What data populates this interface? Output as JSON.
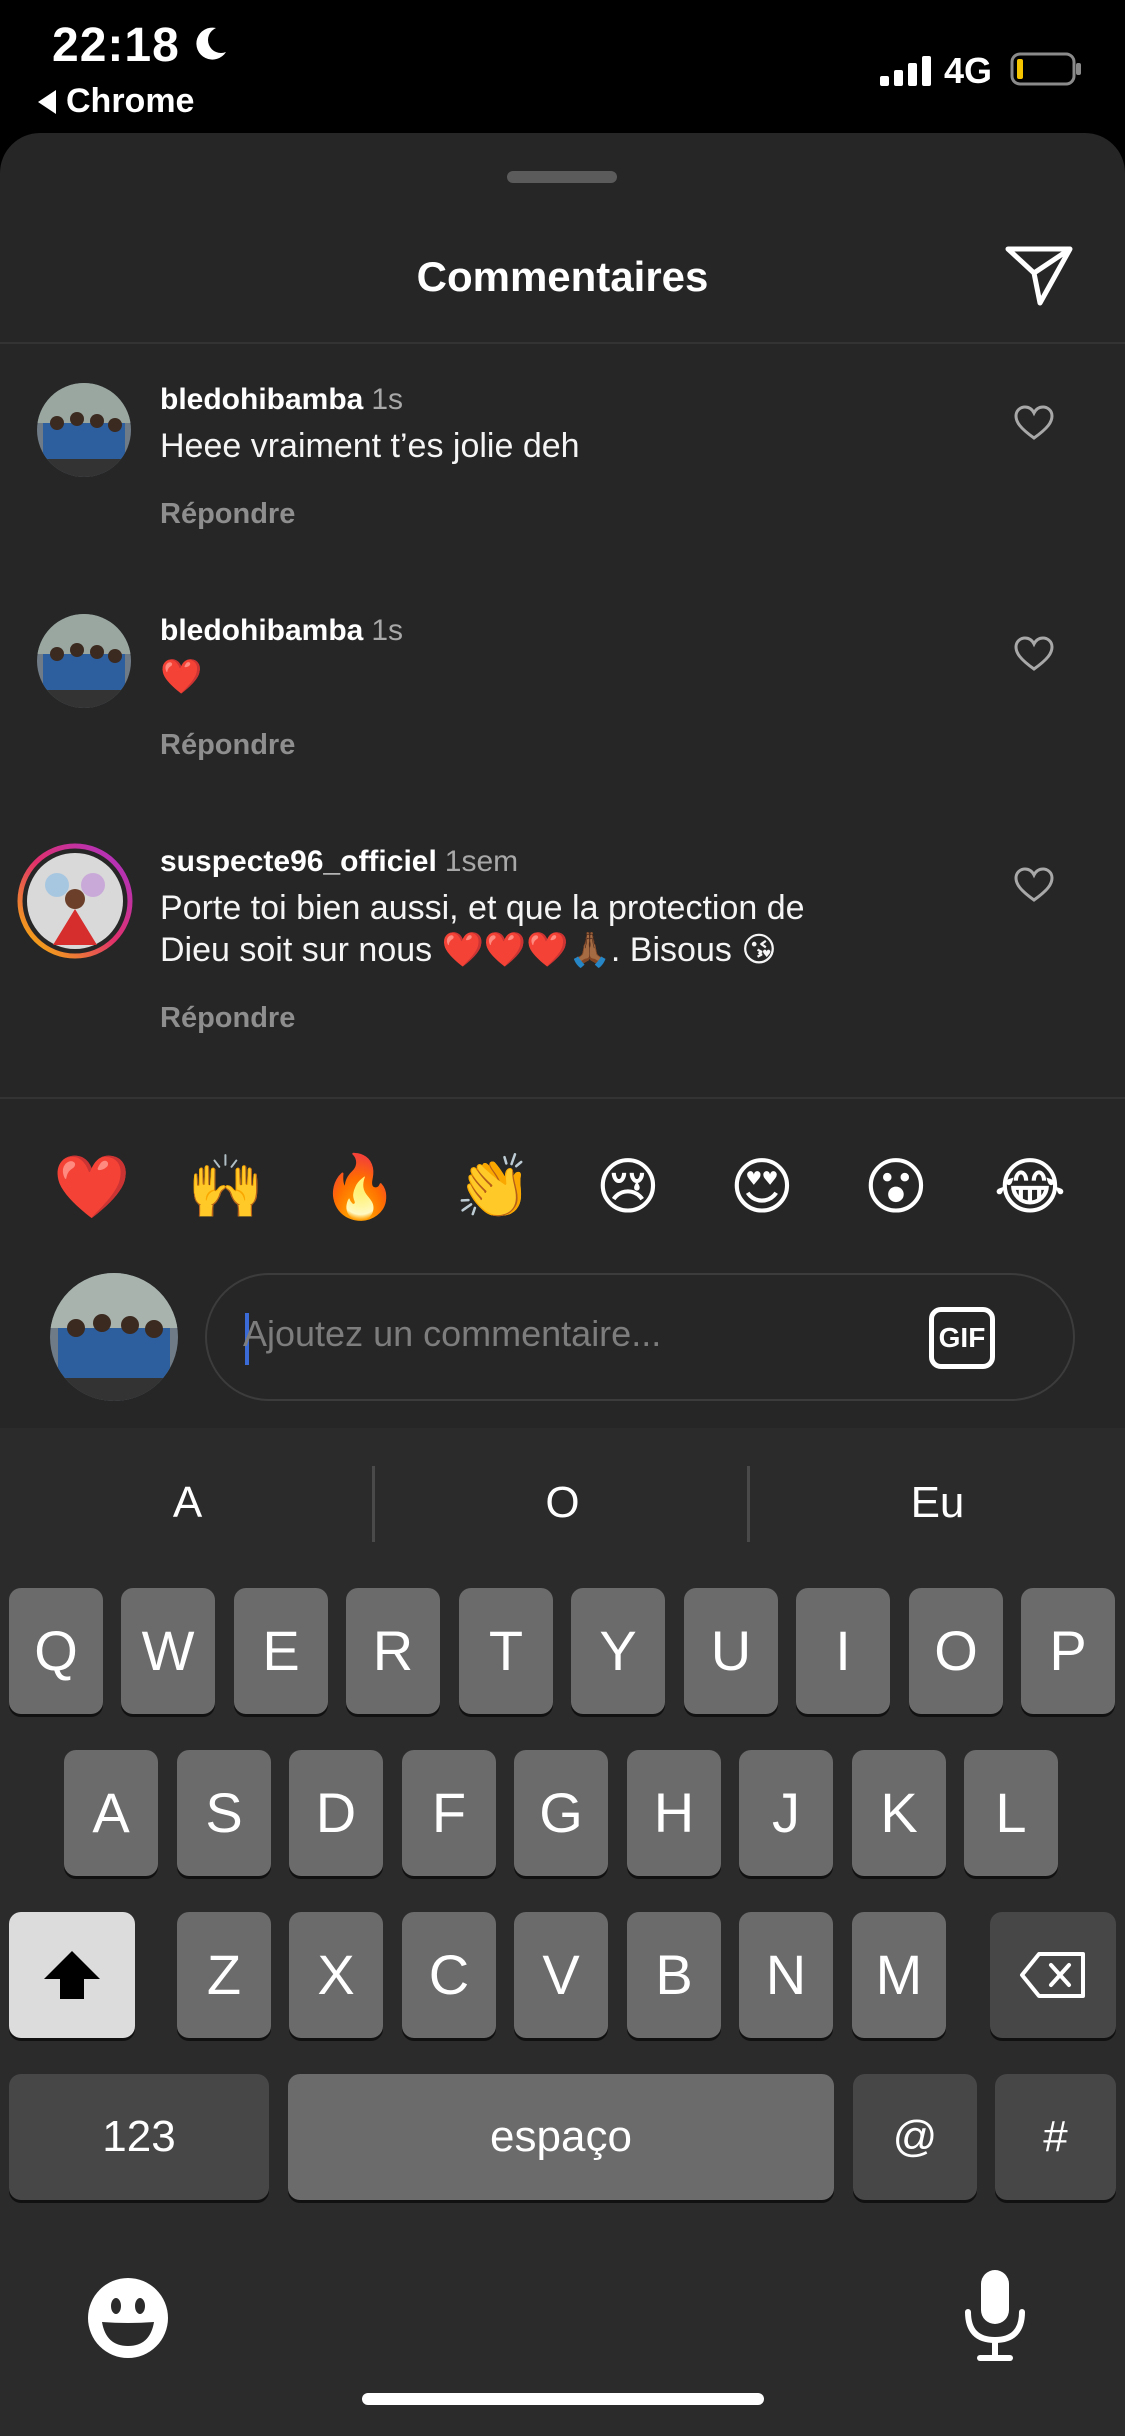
{
  "status_bar": {
    "time": "22:18",
    "back_label": "Chrome",
    "network": "4G"
  },
  "sheet": {
    "title": "Commentaires"
  },
  "comments": [
    {
      "username": "bledohibamba",
      "time": "1s",
      "text": "Heee vraiment t’es jolie deh",
      "reply": "Répondre"
    },
    {
      "username": "bledohibamba",
      "time": "1s",
      "text": "❤️",
      "reply": "Répondre"
    },
    {
      "username": "suspecte96_officiel",
      "time": "1sem",
      "text_line1": "Porte toi bien aussi, et que la protection de",
      "text_line2": "Dieu soit sur nous ❤️❤️❤️🙏🏾. Bisous 😘",
      "reply": "Répondre"
    }
  ],
  "quick_emojis": [
    "❤️",
    "🙌",
    "🔥",
    "👏",
    "😢",
    "😍",
    "😮",
    "😂"
  ],
  "composer": {
    "placeholder": "Ajoutez un commentaire...",
    "gif_label": "GIF"
  },
  "keyboard": {
    "suggestions": [
      "A",
      "O",
      "Eu"
    ],
    "row1": [
      "Q",
      "W",
      "E",
      "R",
      "T",
      "Y",
      "U",
      "I",
      "O",
      "P"
    ],
    "row2": [
      "A",
      "S",
      "D",
      "F",
      "G",
      "H",
      "J",
      "K",
      "L"
    ],
    "row3": [
      "Z",
      "X",
      "C",
      "V",
      "B",
      "N",
      "M"
    ],
    "numbers_label": "123",
    "space_label": "espaço",
    "at_label": "@",
    "hash_label": "#"
  },
  "colors": {
    "sheet_bg": "#262626",
    "keyboard_bg": "#2b2b2b",
    "key_bg": "#6b6b6b",
    "accent_caret": "#3b6bd6"
  }
}
